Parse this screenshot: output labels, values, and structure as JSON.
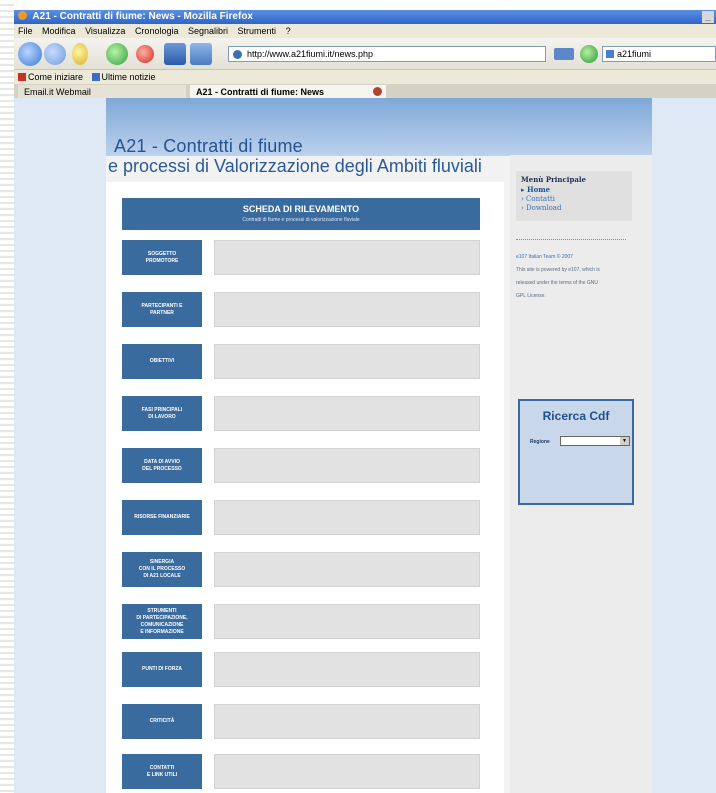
{
  "browser": {
    "window_title": "A21 - Contratti di fiume: News - Mozilla Firefox",
    "menu": [
      "File",
      "Modifica",
      "Visualizza",
      "Cronologia",
      "Segnalibri",
      "Strumenti",
      "?"
    ],
    "url": "http://www.a21fiumi.it/news.php",
    "search_value": "a21fiumi",
    "bookmarks": [
      "Come iniziare",
      "Ultime notizie"
    ],
    "tabs": [
      "Email.it Webmail",
      "A21 - Contratti di fiume: News"
    ],
    "minimize_glyph": "_"
  },
  "site": {
    "title": "A21 - Contratti di fiume",
    "subtitle": "e processi di Valorizzazione degli Ambiti fluviali"
  },
  "form": {
    "header_title": "SCHEDA DI RILEVAMENTO",
    "header_sub": "Contratti di fiume e processi di valorizzazione fluviale",
    "rows": [
      "SOGGETTO\nPROMOTORE",
      "PARTECIPANTI E\nPARTNER",
      "OBIETTIVI",
      "FASI PRINCIPALI\nDI LAVORO",
      "DATA DI AVVIO\nDEL PROCESSO",
      "RISORSE FINANZIARIE",
      "SINERGIA\nCON IL PROCESSO\nDI A21 LOCALE",
      "STRUMENTI\nDI PARTECIPAZIONE,\nCOMUNICAZIONE\nE INFORMAZIONE",
      "PUNTI DI FORZA",
      "CRITICITÀ",
      "CONTATTI\nE LINK UTILI"
    ]
  },
  "sidebar": {
    "menu_title": "Menù Principale",
    "menu_items": [
      "Home",
      "Contatti",
      "Download"
    ],
    "credits": [
      "e107 Italian Team © 2007",
      "This site is powered by e107, which is",
      "released under the terms of the GNU",
      "GPL License."
    ],
    "search_title": "Ricerca Cdf",
    "search_label": "Regione",
    "select_arrow": "▼"
  }
}
